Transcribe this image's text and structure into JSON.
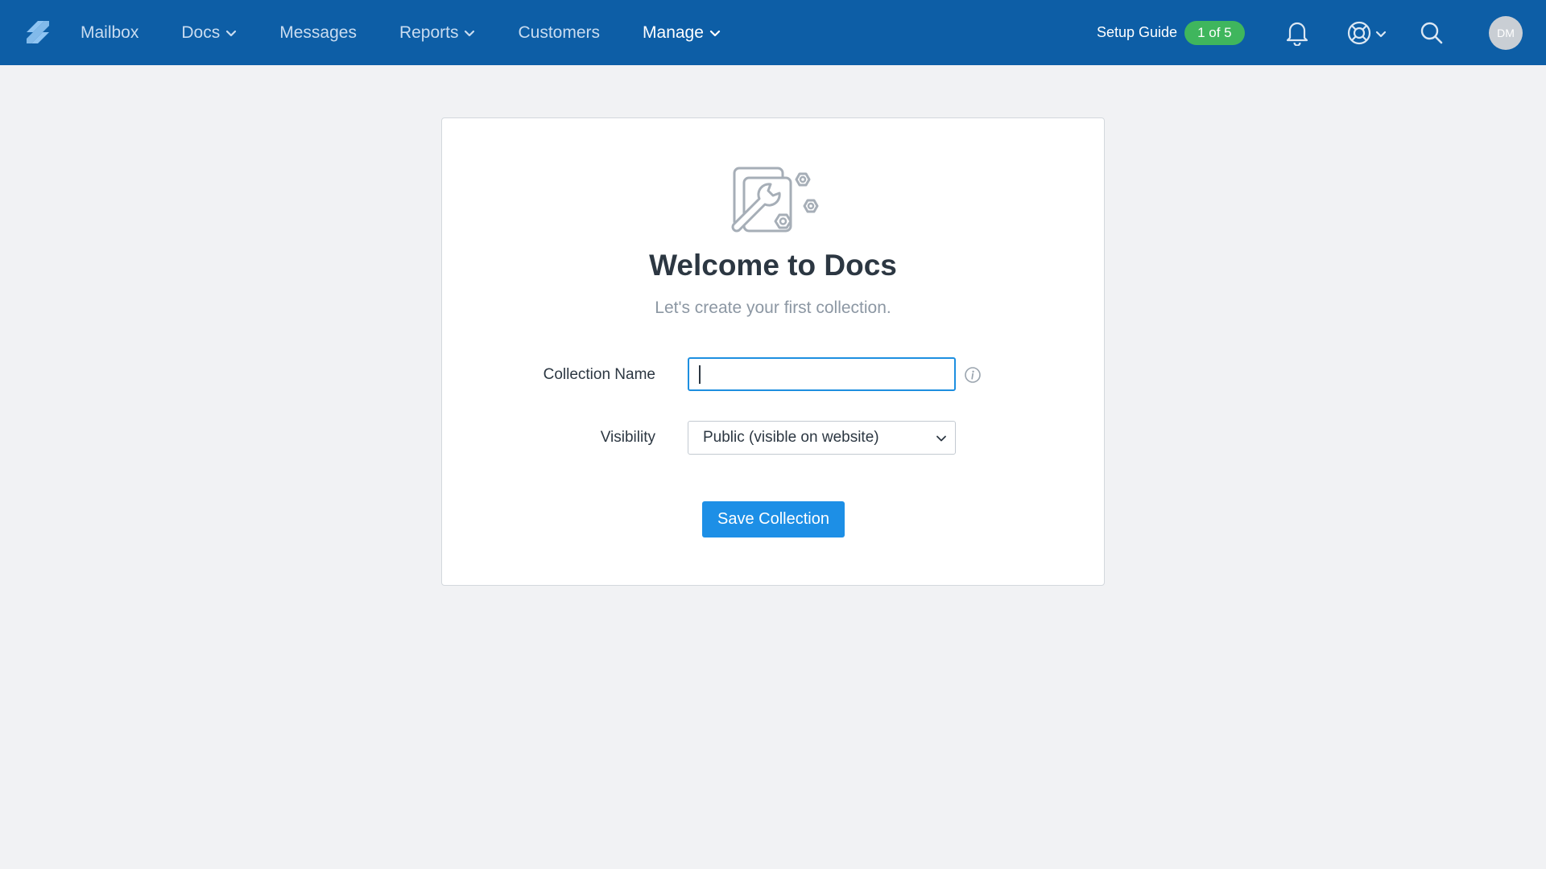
{
  "nav": {
    "items": [
      {
        "label": "Mailbox",
        "has_dropdown": false,
        "active": false
      },
      {
        "label": "Docs",
        "has_dropdown": true,
        "active": false
      },
      {
        "label": "Messages",
        "has_dropdown": false,
        "active": false
      },
      {
        "label": "Reports",
        "has_dropdown": true,
        "active": false
      },
      {
        "label": "Customers",
        "has_dropdown": false,
        "active": false
      },
      {
        "label": "Manage",
        "has_dropdown": true,
        "active": true
      }
    ],
    "icons": {
      "logo": "helpscout-logo-icon",
      "notifications": "bell-icon",
      "help": "lifebuoy-icon",
      "search": "search-icon"
    }
  },
  "setup_guide": {
    "label": "Setup Guide",
    "progress": "1 of 5"
  },
  "user": {
    "initials": "DM"
  },
  "card": {
    "illustration": "wrench-gears-icon",
    "title": "Welcome to Docs",
    "subtitle": "Let's create your first collection.",
    "fields": {
      "collection_name_label": "Collection Name",
      "collection_name_value": "",
      "visibility_label": "Visibility",
      "visibility_value": "Public (visible on website)"
    },
    "save_label": "Save Collection"
  },
  "colors": {
    "topbar": "#0d5ea6",
    "background": "#f1f2f4",
    "primary_button": "#1d8fe6",
    "badge": "#3fb65d"
  }
}
